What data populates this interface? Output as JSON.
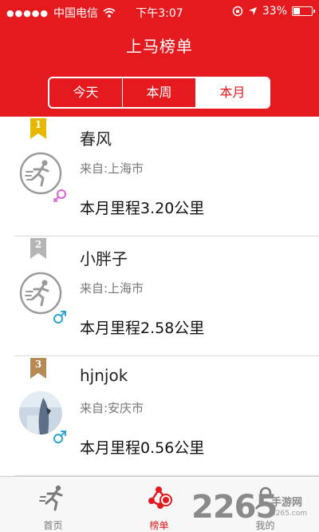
{
  "status_bar": {
    "carrier": "中国电信",
    "time": "下午3:07",
    "battery": "33%",
    "battery_level": 0.33
  },
  "header": {
    "title": "上马榜单"
  },
  "tabs": [
    {
      "label": "今天",
      "active": false
    },
    {
      "label": "本周",
      "active": false
    },
    {
      "label": "本月",
      "active": true
    }
  ],
  "rankings": [
    {
      "rank": "1",
      "name": "春风",
      "from": "来自:上海市",
      "distance": "本月里程3.20公里",
      "gender": "female",
      "avatar": "runner-icon",
      "rank_color": "#e6b800"
    },
    {
      "rank": "2",
      "name": "小胖子",
      "from": "来自:上海市",
      "distance": "本月里程2.58公里",
      "gender": "male",
      "avatar": "runner-icon",
      "rank_color": "#b5b5b5"
    },
    {
      "rank": "3",
      "name": "hjnjok",
      "from": "来自:安庆市",
      "distance": "本月里程0.56公里",
      "gender": "male",
      "avatar": "photo",
      "rank_color": "#b68a55"
    }
  ],
  "tabbar": [
    {
      "label": "首页",
      "icon": "runner-icon",
      "active": false
    },
    {
      "label": "榜单",
      "icon": "ranking-icon",
      "active": true
    },
    {
      "label": "我的",
      "icon": "profile-icon",
      "active": false
    }
  ],
  "watermark": {
    "text": "2265",
    "subtitle": "手游网",
    "url": "2265.com"
  },
  "colors": {
    "primary": "#e41a1f",
    "female": "#e05fd0",
    "male": "#2aa5d6"
  }
}
